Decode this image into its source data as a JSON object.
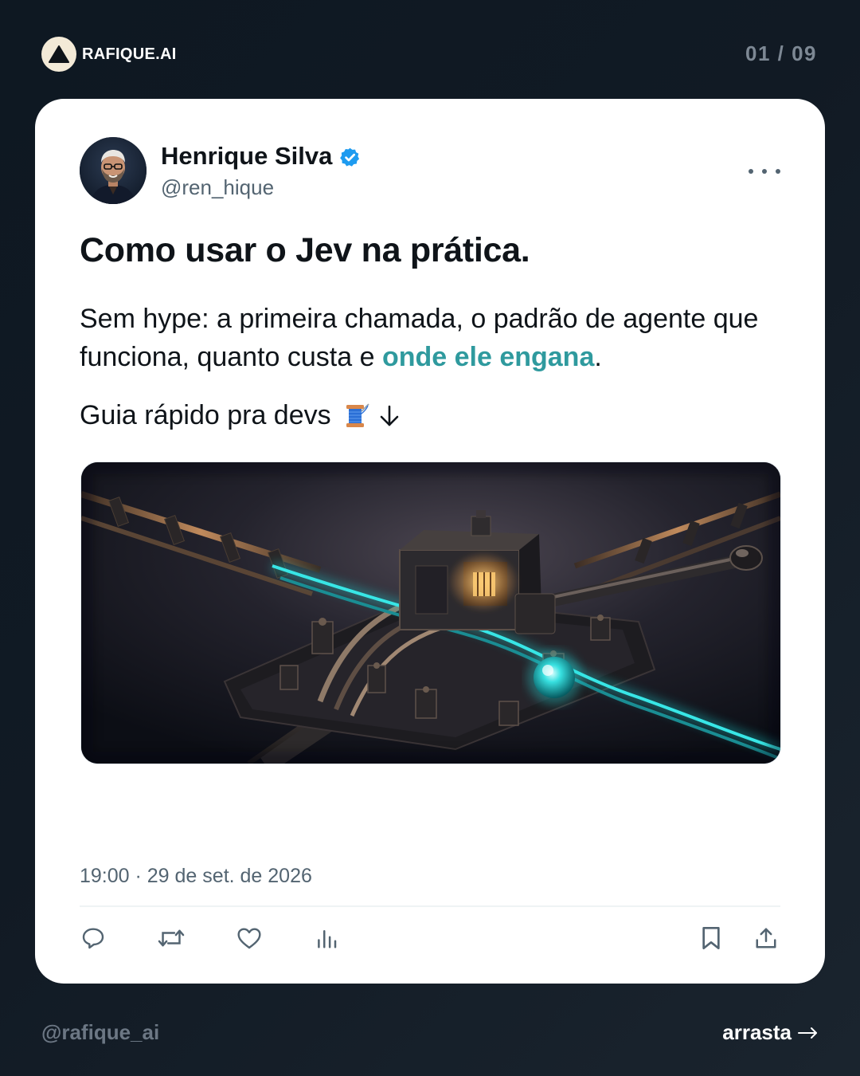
{
  "brand": {
    "name": "RAFIQUE.AI",
    "logo_icon": "triangle-logo-icon"
  },
  "pagination": {
    "label": "01 / 09"
  },
  "post": {
    "author": {
      "name": "Henrique Silva",
      "handle": "@ren_hique",
      "verified": true,
      "verified_color": "#1d9bf0"
    },
    "headline": "Como usar o Jev na prática.",
    "body": {
      "text_before": "Sem hype: a primeira chamada, o padrão de agente que funciona, quanto custa e ",
      "highlight": "onde ele engana",
      "text_after": ".",
      "highlight_color": "#2f9a9e"
    },
    "guide": {
      "text": "Guia rápido pra devs",
      "emoji_icon": "thread-spool-icon",
      "arrow_icon": "arrow-down-icon"
    },
    "media": {
      "icon": "railway-switch-illustration"
    },
    "timestamp": "19:00 · 29 de set. de 2026",
    "actions": {
      "reply": "reply-icon",
      "repost": "repost-icon",
      "like": "like-icon",
      "views": "views-icon",
      "bookmark": "bookmark-icon",
      "share": "share-icon"
    }
  },
  "footer": {
    "handle": "@rafique_ai",
    "swipe_label": "arrasta",
    "swipe_icon": "arrow-right-icon"
  }
}
